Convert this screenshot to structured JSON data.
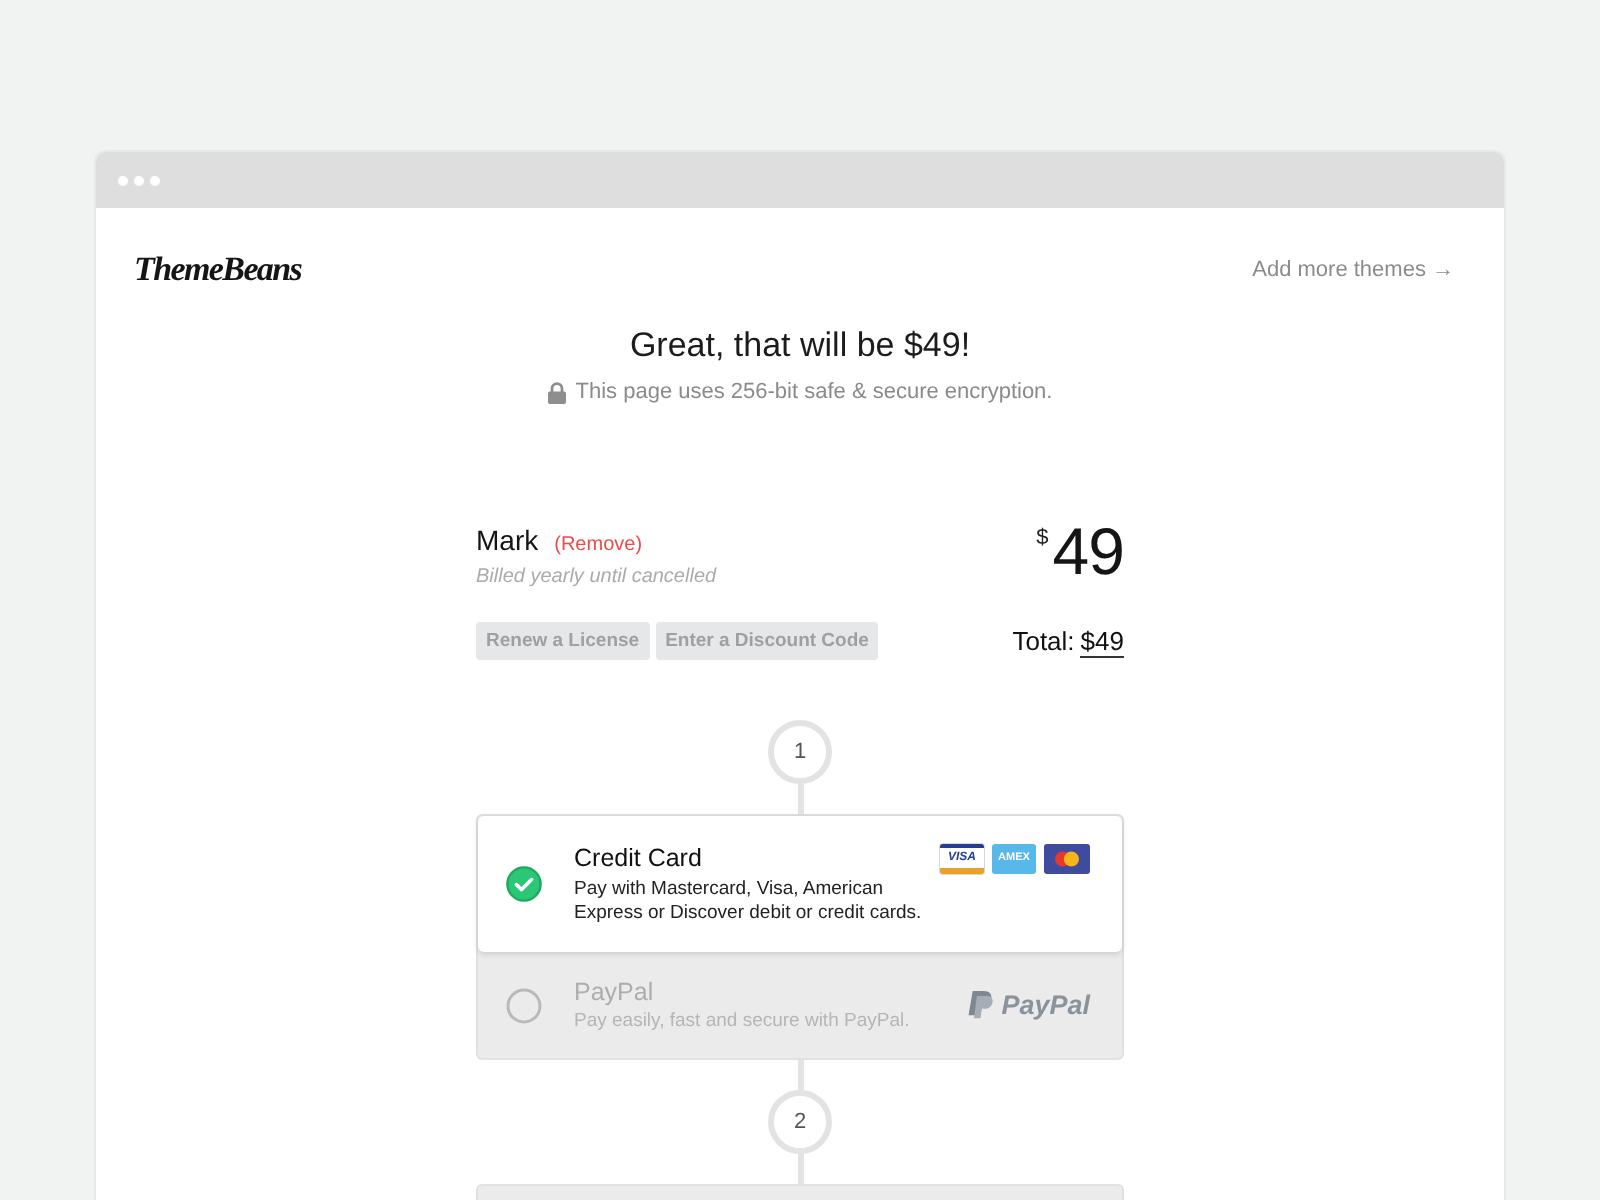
{
  "header": {
    "logo": "ThemeBeans",
    "link": "Add more themes →"
  },
  "summary": {
    "title": "Great, that will be $49!",
    "security_note": "This page uses 256-bit safe & secure encryption."
  },
  "order": {
    "product": "Mark",
    "remove_link": "(Remove)",
    "billing": "Billed yearly until cancelled",
    "currency": "$",
    "price": "49",
    "actions": [
      "Renew a License",
      "Enter a Discount Code"
    ],
    "total_label": "Total:",
    "total": "$49"
  },
  "steps": [
    {
      "number": "1",
      "payment_methods": [
        {
          "name": "Credit Card",
          "description": "Pay with Mastercard, Visa, American Express or Discover debit or credit cards.",
          "selected": true,
          "logos": [
            {
              "kind": "visa",
              "label": "VISA"
            },
            {
              "kind": "amex",
              "label": "AMEX"
            },
            {
              "kind": "mastercard"
            }
          ]
        },
        {
          "name": "PayPal",
          "description": "Pay easily, fast and secure with PayPal.",
          "selected": false,
          "logos": [
            {
              "kind": "paypal",
              "label": "PayPal"
            }
          ]
        }
      ]
    },
    {
      "number": "2"
    }
  ]
}
